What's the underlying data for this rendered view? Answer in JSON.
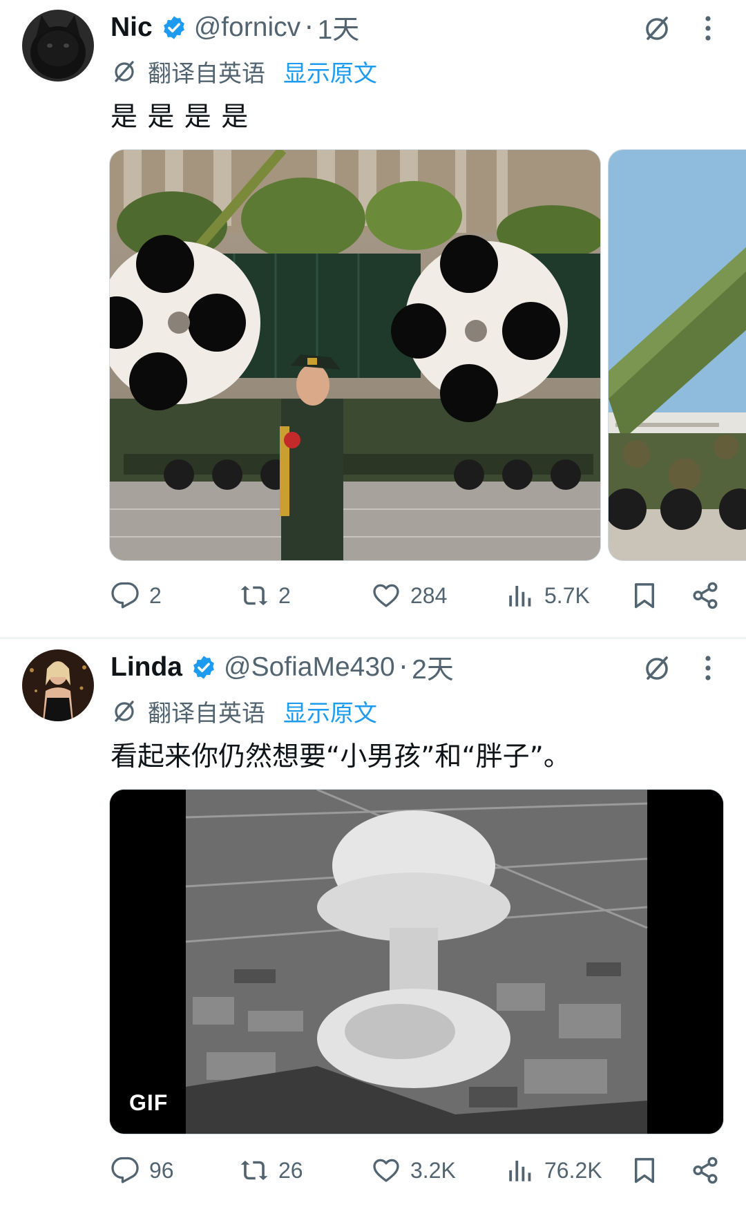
{
  "colors": {
    "text_primary": "#0f1419",
    "text_secondary": "#536471",
    "link": "#1d9bf0",
    "verified": "#1d9bf0"
  },
  "tweets": [
    {
      "name": "Nic",
      "handle": "@fornicv",
      "time": "1天",
      "translated_label": "翻译自英语",
      "show_original": "显示原文",
      "text": "是 是 是 是",
      "media": [
        "image-parade-rocket-launchers",
        "image-missile-on-truck"
      ],
      "replies": "2",
      "reposts": "2",
      "likes": "284",
      "views": "5.7K"
    },
    {
      "name": "Linda",
      "handle": "@SofiaMe430",
      "time": "2天",
      "translated_label": "翻译自英语",
      "show_original": "显示原文",
      "text": "看起来你仍然想要“小男孩”和“胖子”。",
      "media": [
        "gif-mushroom-cloud"
      ],
      "gif_label": "GIF",
      "replies": "96",
      "reposts": "26",
      "likes": "3.2K",
      "views": "76.2K"
    }
  ],
  "icons": [
    "verified-badge-icon",
    "grok-icon",
    "more-icon",
    "translate-icon",
    "reply-icon",
    "repost-icon",
    "like-icon",
    "views-icon",
    "bookmark-icon",
    "share-icon"
  ]
}
